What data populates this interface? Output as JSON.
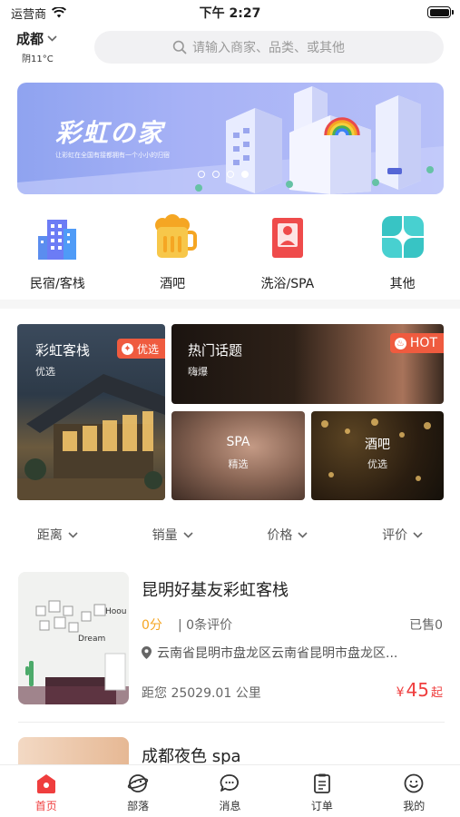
{
  "status_bar": {
    "carrier": "运营商",
    "time": "下午 2:27"
  },
  "location": {
    "city": "成都",
    "weather": "阴11°C"
  },
  "search": {
    "placeholder": "请输入商家、品类、或其他"
  },
  "banner": {
    "title": "彩虹の家",
    "subtitle": "让彩虹在全国有接都拥有一个小小的归宿",
    "slide_count": 4,
    "active_slide": 4
  },
  "categories": [
    {
      "label": "民宿/客栈",
      "icon": "building-icon"
    },
    {
      "label": "酒吧",
      "icon": "beer-icon"
    },
    {
      "label": "洗浴/SPA",
      "icon": "bath-icon"
    },
    {
      "label": "其他",
      "icon": "clover-icon"
    }
  ],
  "promo_tiles": {
    "rainbow_inn": {
      "title": "彩虹客栈",
      "subtitle": "优选",
      "tag": "优选"
    },
    "hot_topics": {
      "title": "热门话题",
      "subtitle": "嗨爆",
      "tag": "HOT"
    },
    "spa": {
      "title": "SPA",
      "subtitle": "精选"
    },
    "bar": {
      "title": "酒吧",
      "subtitle": "优选"
    }
  },
  "filters": [
    "距离",
    "销量",
    "价格",
    "评价"
  ],
  "listings": [
    {
      "name": "昆明好基友彩虹客栈",
      "score": "0分",
      "reviews": "| 0条评价",
      "sold": "已售0",
      "address": "云南省昆明市盘龙区云南省昆明市盘龙区...",
      "distance": "距您 25029.01 公里",
      "currency": "¥",
      "price": "45",
      "price_suffix": "起"
    },
    {
      "name": "成都夜色 spa"
    }
  ],
  "tabs": [
    {
      "label": "首页",
      "icon": "home-icon",
      "active": true
    },
    {
      "label": "部落",
      "icon": "tribe-icon",
      "active": false
    },
    {
      "label": "消息",
      "icon": "message-icon",
      "active": false
    },
    {
      "label": "订单",
      "icon": "order-icon",
      "active": false
    },
    {
      "label": "我的",
      "icon": "profile-icon",
      "active": false
    }
  ],
  "colors": {
    "accent": "#ef3e3e",
    "tag": "#ef5b3f",
    "score": "#f5a623",
    "banner": "#a7b2f6"
  }
}
